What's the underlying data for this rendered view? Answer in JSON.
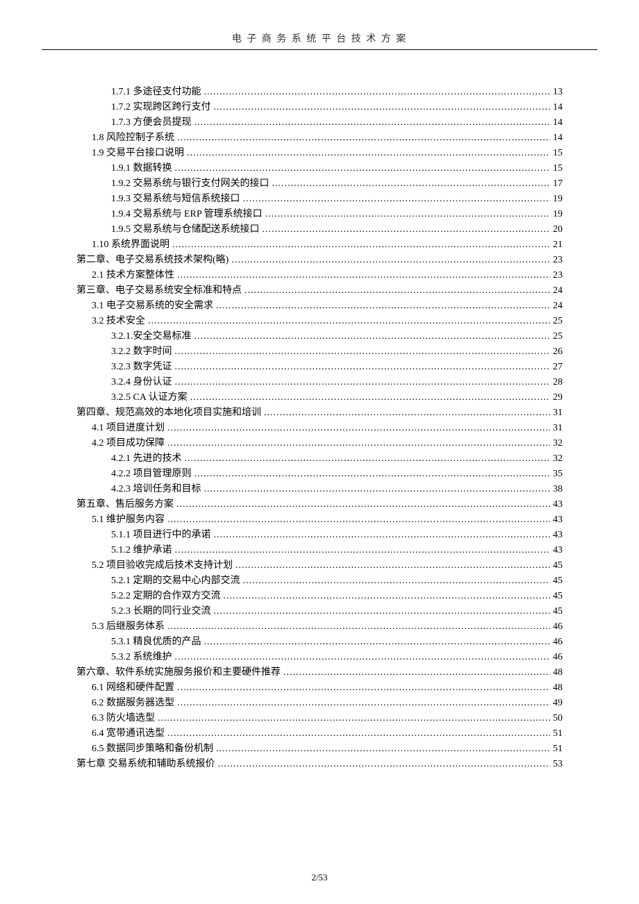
{
  "header": {
    "title": "电 子 商 务 系 统 平 台 技 术 方 案"
  },
  "toc": [
    {
      "indent": 2,
      "label": "1.7.1 多途径支付功能",
      "page": "13"
    },
    {
      "indent": 2,
      "label": "1.7.2 实现跨区跨行支付",
      "page": "14"
    },
    {
      "indent": 2,
      "label": "1.7.3 方便会员提现",
      "page": "14"
    },
    {
      "indent": 1,
      "label": "1.8 风险控制子系统",
      "page": "14"
    },
    {
      "indent": 1,
      "label": "1.9 交易平台接口说明",
      "page": "15"
    },
    {
      "indent": 2,
      "label": "1.9.1 数据转换",
      "page": "15"
    },
    {
      "indent": 2,
      "label": "1.9.2 交易系统与银行支付网关的接口",
      "page": "17"
    },
    {
      "indent": 2,
      "label": "1.9.3 交易系统与短信系统接口",
      "page": "19"
    },
    {
      "indent": 2,
      "label": "1.9.4 交易系统与 ERP 管理系统接口",
      "page": "19"
    },
    {
      "indent": 2,
      "label": "1.9.5 交易系统与仓储配送系统接口",
      "page": "20"
    },
    {
      "indent": 1,
      "label": "1.10 系统界面说明",
      "page": "21"
    },
    {
      "indent": 0,
      "label": "第二章、电子交易系统技术架构(略)",
      "page": "23"
    },
    {
      "indent": 1,
      "label": "2.1 技术方案整体性",
      "page": "23"
    },
    {
      "indent": 0,
      "label": "第三章、电子交易系统安全标准和特点",
      "page": "24"
    },
    {
      "indent": 1,
      "label": "3.1 电子交易系统的安全需求",
      "page": "24"
    },
    {
      "indent": 1,
      "label": "3.2 技术安全",
      "page": "25"
    },
    {
      "indent": 2,
      "label": "3.2.1.安全交易标准",
      "page": "25"
    },
    {
      "indent": 2,
      "label": "3.2.2 数字时间",
      "page": "26"
    },
    {
      "indent": 2,
      "label": "3.2.3 数字凭证",
      "page": "27"
    },
    {
      "indent": 2,
      "label": "3.2.4 身份认证",
      "page": "28"
    },
    {
      "indent": 2,
      "label": "3.2.5 CA 认证方案",
      "page": "29"
    },
    {
      "indent": 0,
      "label": "第四章、规范高效的本地化项目实施和培训",
      "page": "31"
    },
    {
      "indent": 1,
      "label": "4.1 项目进度计划",
      "page": "31"
    },
    {
      "indent": 1,
      "label": "4.2 项目成功保障",
      "page": "32"
    },
    {
      "indent": 2,
      "label": "4.2.1 先进的技术",
      "page": "32"
    },
    {
      "indent": 2,
      "label": "4.2.2 项目管理原则",
      "page": "35"
    },
    {
      "indent": 2,
      "label": "4.2.3 培训任务和目标",
      "page": "38"
    },
    {
      "indent": 0,
      "label": "第五章、售后服务方案",
      "page": "43"
    },
    {
      "indent": 1,
      "label": "5.1 维护服务内容",
      "page": "43"
    },
    {
      "indent": 2,
      "label": "5.1.1  项目进行中的承诺",
      "page": "43"
    },
    {
      "indent": 2,
      "label": "5.1.2  维护承诺",
      "page": "43"
    },
    {
      "indent": 1,
      "label": "5.2 项目验收完成后技术支持计划",
      "page": "45"
    },
    {
      "indent": 2,
      "label": "5.2.1  定期的交易中心内部交流",
      "page": "45"
    },
    {
      "indent": 2,
      "label": "5.2.2  定期的合作双方交流",
      "page": "45"
    },
    {
      "indent": 2,
      "label": "5.2.3  长期的同行业交流",
      "page": "45"
    },
    {
      "indent": 1,
      "label": "5.3 后继服务体系",
      "page": "46"
    },
    {
      "indent": 2,
      "label": "5.3.1  精良优质的产品",
      "page": "46"
    },
    {
      "indent": 2,
      "label": "5.3.2  系统维护",
      "page": "46"
    },
    {
      "indent": 0,
      "label": "第六章、软件系统实施服务报价和主要硬件推荐",
      "page": "48"
    },
    {
      "indent": 1,
      "label": "6.1 网络和硬件配置",
      "page": "48"
    },
    {
      "indent": 1,
      "label": "6.2 数据服务器选型",
      "page": "49"
    },
    {
      "indent": 1,
      "label": "6.3 防火墙选型",
      "page": "50"
    },
    {
      "indent": 1,
      "label": "6.4 宽带通讯选型",
      "page": "51"
    },
    {
      "indent": 1,
      "label": "6.5 数据同步策略和备份机制",
      "page": "51"
    },
    {
      "indent": 0,
      "label": "第七章 交易系统和辅助系统报价",
      "page": "53"
    }
  ],
  "footer": {
    "pageNumber": "2/53"
  }
}
